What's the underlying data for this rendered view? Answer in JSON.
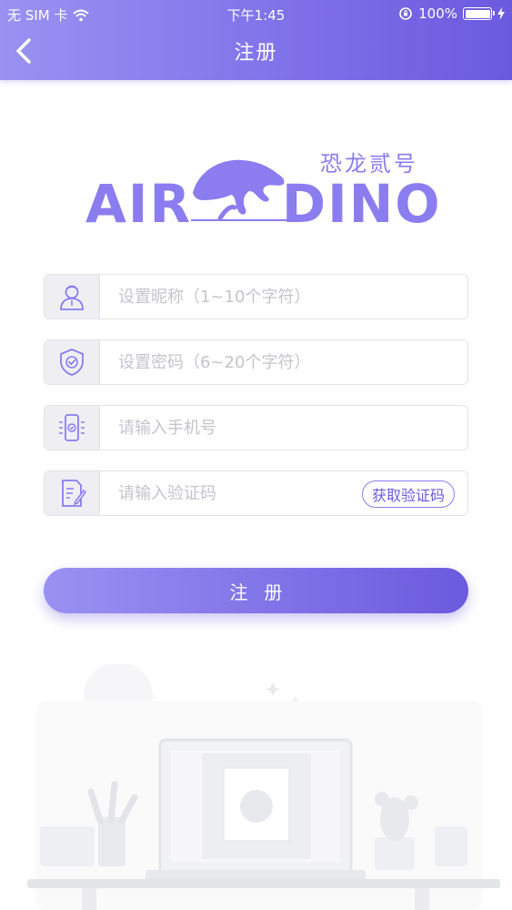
{
  "status_bar": {
    "carrier": "无 SIM 卡",
    "time": "下午1:45",
    "battery_percent": "100%",
    "battery_level": 1.0
  },
  "nav": {
    "back_icon": "chevron-left-icon",
    "title": "注册"
  },
  "logo": {
    "text_left": "AIR",
    "text_right": "DINO",
    "subtitle": "恐龙贰号"
  },
  "form": {
    "nickname": {
      "icon": "user-icon",
      "placeholder": "设置昵称（1~10个字符）",
      "value": ""
    },
    "password": {
      "icon": "shield-check-icon",
      "placeholder": "设置密码（6~20个字符）",
      "value": ""
    },
    "phone": {
      "icon": "phone-icon",
      "placeholder": "请输入手机号",
      "value": ""
    },
    "code": {
      "icon": "edit-document-icon",
      "placeholder": "请输入验证码",
      "value": "",
      "get_code_label": "获取验证码"
    },
    "submit_label": "注册"
  },
  "colors": {
    "accent": "#7e6fe8",
    "accent_light": "#9a91f2",
    "accent_dark": "#6b5ade"
  }
}
